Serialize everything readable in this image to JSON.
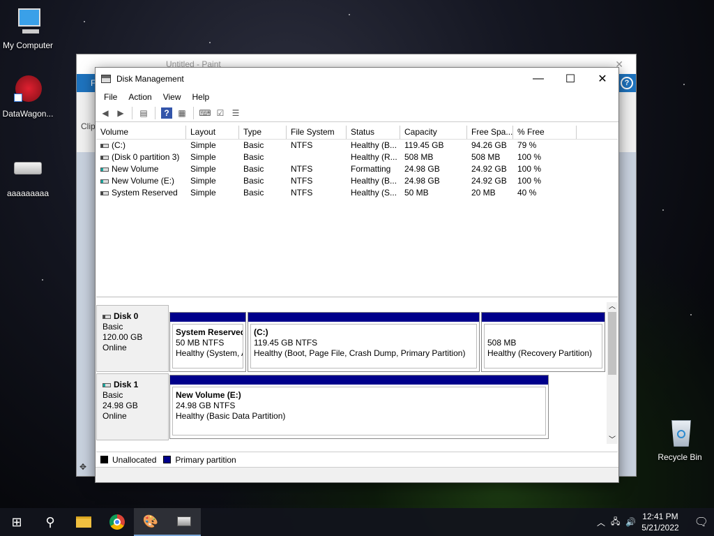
{
  "desktop": {
    "icons": [
      {
        "label": "My Computer"
      },
      {
        "label": "DataWagon..."
      },
      {
        "label": "aaaaaaaaa"
      },
      {
        "label": "Recycle Bin"
      }
    ]
  },
  "paint": {
    "title": "Untitled - Paint",
    "ribbon_file": "F",
    "clip_label": "Clip"
  },
  "disk_management": {
    "title": "Disk Management",
    "menu": [
      "File",
      "Action",
      "View",
      "Help"
    ],
    "columns": [
      "Volume",
      "Layout",
      "Type",
      "File System",
      "Status",
      "Capacity",
      "Free Spa...",
      "% Free"
    ],
    "volumes": [
      {
        "volume": "(C:)",
        "layout": "Simple",
        "type": "Basic",
        "fs": "NTFS",
        "status": "Healthy (B...",
        "capacity": "119.45 GB",
        "free": "94.26 GB",
        "pct": "79 %"
      },
      {
        "volume": "(Disk 0 partition 3)",
        "layout": "Simple",
        "type": "Basic",
        "fs": "",
        "status": "Healthy (R...",
        "capacity": "508 MB",
        "free": "508 MB",
        "pct": "100 %"
      },
      {
        "volume": "New Volume",
        "layout": "Simple",
        "type": "Basic",
        "fs": "NTFS",
        "status": "Formatting",
        "capacity": "24.98 GB",
        "free": "24.92 GB",
        "pct": "100 %"
      },
      {
        "volume": "New Volume (E:)",
        "layout": "Simple",
        "type": "Basic",
        "fs": "NTFS",
        "status": "Healthy (B...",
        "capacity": "24.98 GB",
        "free": "24.92 GB",
        "pct": "100 %"
      },
      {
        "volume": "System Reserved",
        "layout": "Simple",
        "type": "Basic",
        "fs": "NTFS",
        "status": "Healthy (S...",
        "capacity": "50 MB",
        "free": "20 MB",
        "pct": "40 %"
      }
    ],
    "disk0": {
      "name": "Disk 0",
      "kind": "Basic",
      "size": "120.00 GB",
      "state": "Online",
      "p1": {
        "name": "System Reserved",
        "size": "50 MB NTFS",
        "status": "Healthy (System, A"
      },
      "p2": {
        "name": "(C:)",
        "size": "119.45 GB NTFS",
        "status": "Healthy (Boot, Page File, Crash Dump, Primary Partition)"
      },
      "p3": {
        "size": "508 MB",
        "status": "Healthy (Recovery Partition)"
      }
    },
    "disk1": {
      "name": "Disk 1",
      "kind": "Basic",
      "size": "24.98 GB",
      "state": "Online",
      "p1": {
        "name": "New Volume  (E:)",
        "size": "24.98 GB NTFS",
        "status": "Healthy (Basic Data Partition)"
      }
    },
    "legend": {
      "unallocated": "Unallocated",
      "primary": "Primary partition"
    },
    "colors": {
      "primary": "#00008b",
      "unallocated": "#000000"
    }
  },
  "taskbar": {
    "time": "12:41 PM",
    "date": "5/21/2022"
  }
}
